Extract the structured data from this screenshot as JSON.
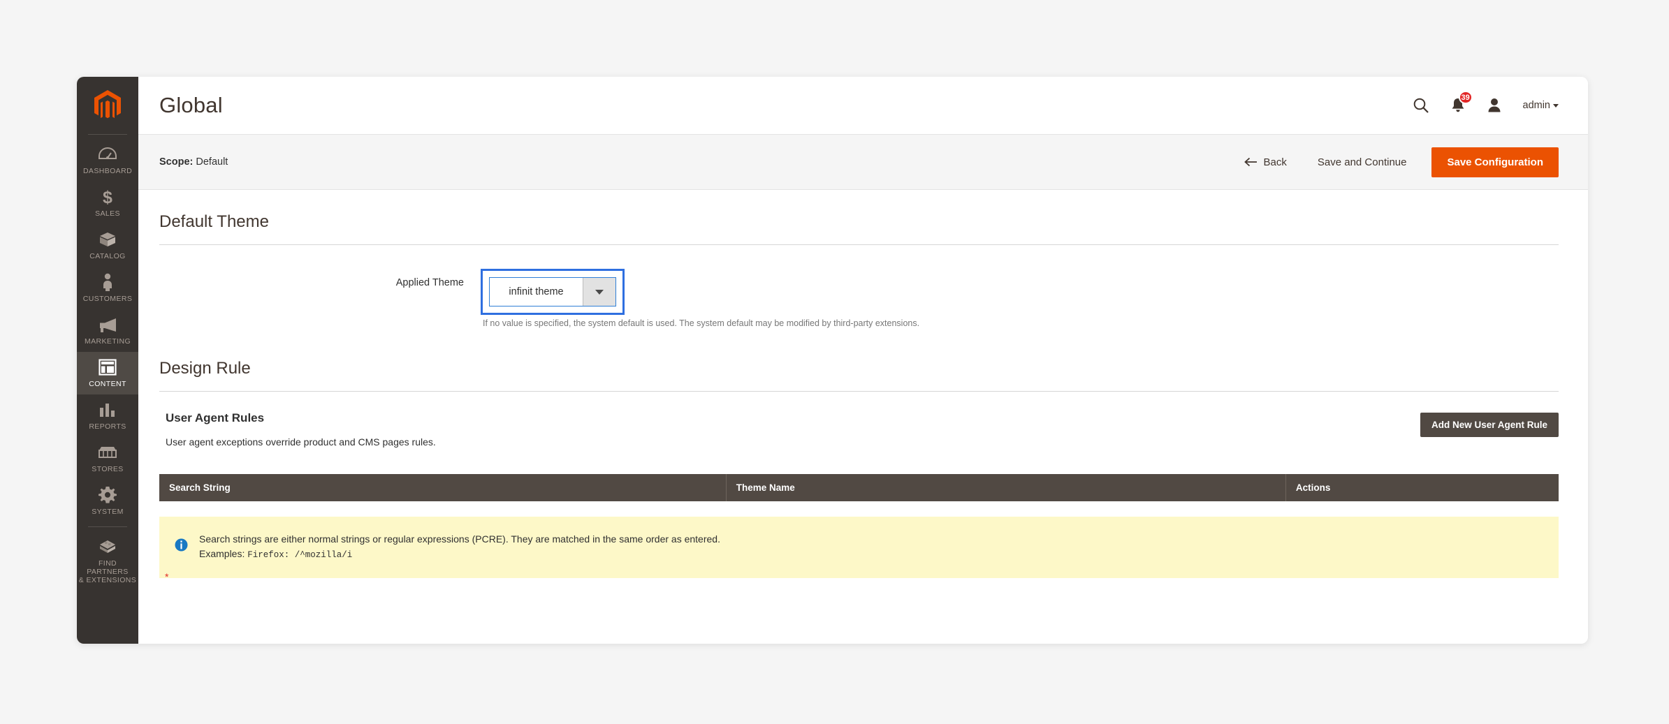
{
  "window": {
    "accent_orange": "#eb5202",
    "sidebar_bg": "#373330",
    "sidebar_active_bg": "#4f4a45",
    "notice_bg": "#fdf8c8",
    "table_header_bg": "#514943",
    "focus_ring_color": "#2f6fe0"
  },
  "sidebar": {
    "logo": "magento-logo-icon",
    "items": [
      {
        "label": "DASHBOARD",
        "icon": "dashboard-icon",
        "active": false
      },
      {
        "label": "SALES",
        "icon": "dollar-icon",
        "active": false
      },
      {
        "label": "CATALOG",
        "icon": "box-icon",
        "active": false
      },
      {
        "label": "CUSTOMERS",
        "icon": "person-icon",
        "active": false
      },
      {
        "label": "MARKETING",
        "icon": "megaphone-icon",
        "active": false
      },
      {
        "label": "CONTENT",
        "icon": "layout-icon",
        "active": true
      },
      {
        "label": "REPORTS",
        "icon": "bar-chart-icon",
        "active": false
      },
      {
        "label": "STORES",
        "icon": "storefront-icon",
        "active": false
      },
      {
        "label": "SYSTEM",
        "icon": "gear-icon",
        "active": false
      },
      {
        "label": "FIND PARTNERS\n& EXTENSIONS",
        "icon": "extensions-icon",
        "active": false
      }
    ]
  },
  "header": {
    "title": "Global",
    "search_icon": "search-icon",
    "notifications_icon": "bell-icon",
    "notifications_count": "39",
    "avatar_icon": "user-icon",
    "admin_label": "admin"
  },
  "action_bar": {
    "scope_label": "Scope:",
    "scope_value": "Default",
    "back_label": "Back",
    "save_continue_label": "Save and Continue",
    "save_config_label": "Save Configuration"
  },
  "default_theme": {
    "section_title": "Default Theme",
    "field_label": "Applied Theme",
    "selected_value": "infinit theme",
    "note": "If no value is specified, the system default is used. The system default may be modified by third-party extensions."
  },
  "design_rule": {
    "section_title": "Design Rule",
    "sub_title": "User Agent Rules",
    "sub_description": "User agent exceptions override product and CMS pages rules.",
    "add_button_label": "Add New User Agent Rule",
    "table": {
      "columns": [
        "Search String",
        "Theme Name",
        "Actions"
      ],
      "rows": []
    },
    "notice": {
      "icon": "info-icon",
      "line1": "Search strings are either normal strings or regular expressions (PCRE). They are matched in the same order as entered.",
      "line2_prefix": "Examples:",
      "line2_code": "Firefox: /^mozilla/i"
    },
    "cut_marker": "*"
  }
}
